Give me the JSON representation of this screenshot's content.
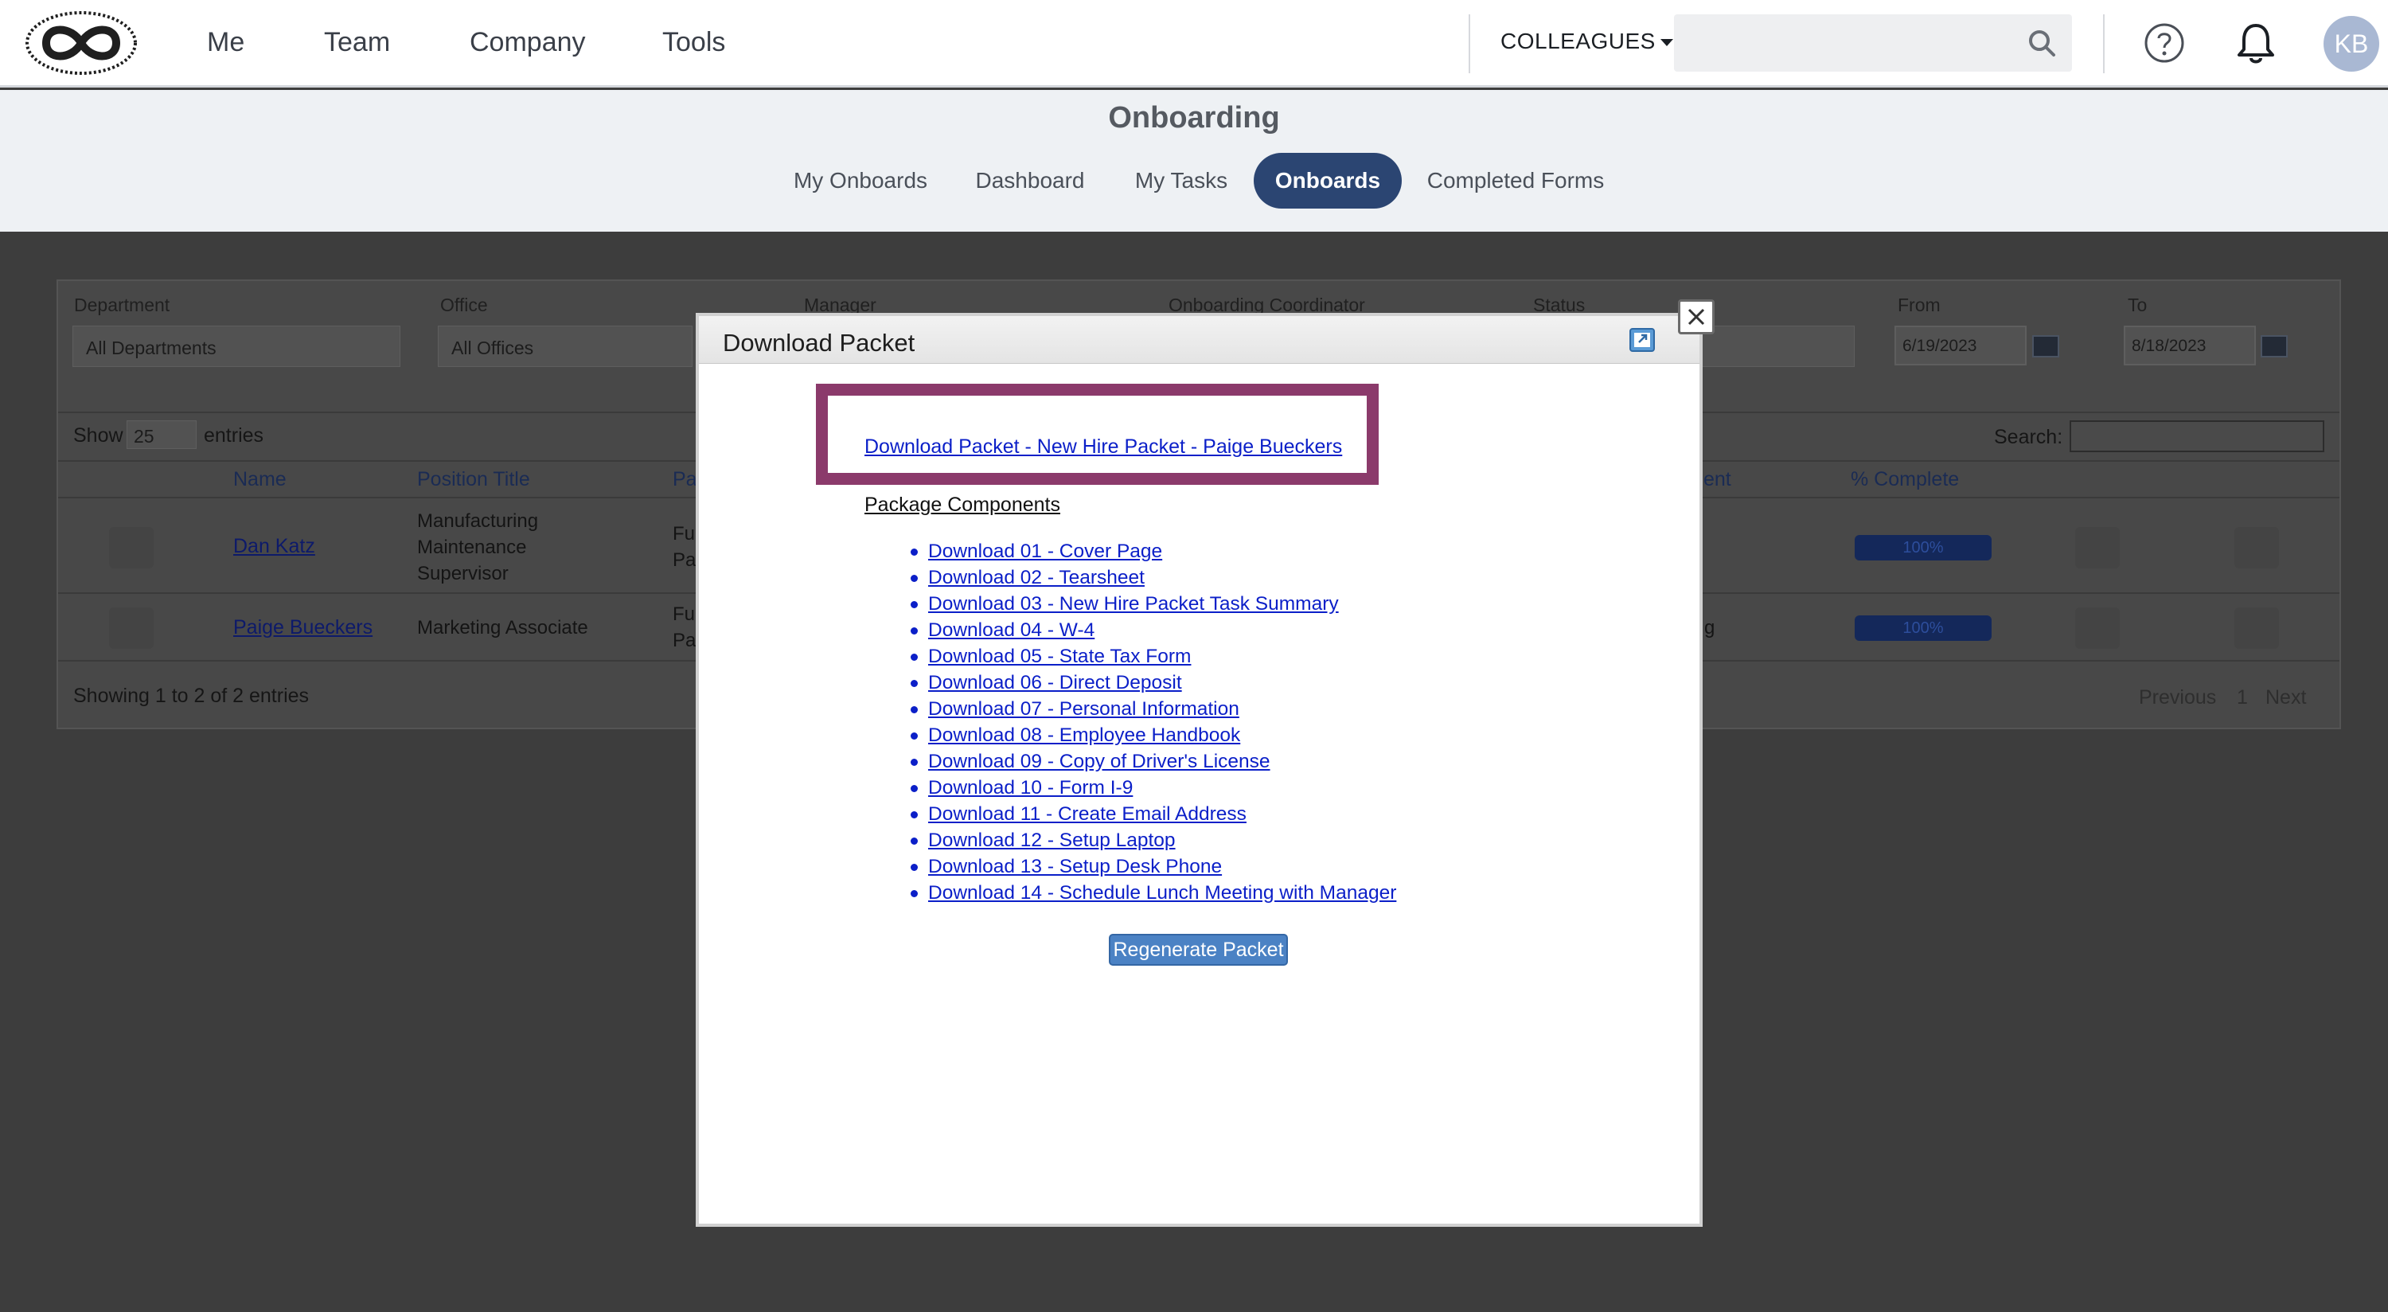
{
  "nav": {
    "links": [
      "Me",
      "Team",
      "Company",
      "Tools"
    ],
    "colleagues_label": "COLLEAGUES",
    "search_value": "",
    "avatar_initials": "KB"
  },
  "subheader": {
    "title": "Onboarding",
    "tabs": [
      {
        "label": "My Onboards",
        "active": false
      },
      {
        "label": "Dashboard",
        "active": false
      },
      {
        "label": "My Tasks",
        "active": false
      },
      {
        "label": "Onboards",
        "active": true
      },
      {
        "label": "Completed Forms",
        "active": false
      }
    ]
  },
  "filters": {
    "department_label": "Department",
    "department_value": "All Departments",
    "office_label": "Office",
    "office_value": "All Offices",
    "manager_label": "Manager",
    "coordinator_label": "Onboarding Coordinator",
    "status_label": "Status",
    "from_label": "From",
    "from_value": "6/19/2023",
    "to_label": "To",
    "to_value": "8/18/2023"
  },
  "table": {
    "show_label": "Show",
    "page_size": "25",
    "entries_label": "entries",
    "search_label": "Search:",
    "headers": [
      "Name",
      "Position Title",
      "Pa",
      "ent",
      "% Complete"
    ],
    "rows": [
      {
        "name": "Dan Katz",
        "position_lines": [
          "Manufacturing",
          "Maintenance",
          "Supervisor"
        ],
        "partial_lines": [
          "Fu",
          "Pa"
        ],
        "status_partial": "",
        "progress_label": "100%",
        "progress": 1.0
      },
      {
        "name": "Paige Bueckers",
        "position_lines": [
          "Marketing Associate"
        ],
        "partial_lines": [
          "Fu",
          "Pa"
        ],
        "status_partial": "g",
        "progress_label": "100%",
        "progress": 1.0
      }
    ],
    "info": "Showing 1 to 2 of 2 entries",
    "pagination": {
      "previous": "Previous",
      "page": "1",
      "next": "Next"
    }
  },
  "modal": {
    "title": "Download Packet",
    "packet_link": "Download Packet - New Hire Packet - Paige Bueckers",
    "components_label": "Package Components",
    "components": [
      "Download 01 - Cover Page",
      "Download 02 - Tearsheet",
      "Download 03 - New Hire Packet Task Summary",
      "Download 04 - W-4",
      "Download 05 - State Tax Form",
      "Download 06 - Direct Deposit",
      "Download 07 - Personal Information",
      "Download 08 - Employee Handbook",
      "Download 09 - Copy of Driver's License",
      "Download 10 - Form I-9",
      "Download 11 - Create Email Address",
      "Download 12 - Setup Laptop",
      "Download 13 - Setup Desk Phone",
      "Download 14 - Schedule Lunch Meeting with Manager"
    ],
    "regenerate_label": "Regenerate Packet",
    "highlight_color": "#8b3a6b"
  },
  "colors": {
    "accent": "#2b4572",
    "link": "#0b1fc8",
    "overlay": "#3d3d3d",
    "button": "#4b82c4"
  }
}
